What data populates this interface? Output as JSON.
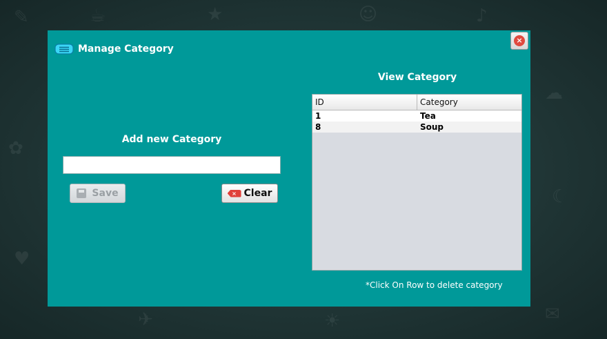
{
  "window": {
    "title": "Manage Category",
    "close_symbol": "×"
  },
  "add_section": {
    "heading": "Add new Category",
    "input_value": "",
    "save_label": "Save",
    "clear_label": "Clear",
    "clear_icon_symbol": "×"
  },
  "view_section": {
    "heading": "View Category",
    "columns": [
      "ID",
      "Category"
    ],
    "rows": [
      {
        "id": "1",
        "category": "Tea"
      },
      {
        "id": "8",
        "category": "Soup"
      }
    ],
    "hint": "*Click On Row to delete category"
  },
  "colors": {
    "panel": "#009999",
    "background": "#1f3434",
    "close_red": "#e04a3f"
  },
  "icons": {
    "title": "menu-list-icon",
    "close": "close-circle-icon",
    "save": "floppy-disk-icon",
    "clear": "backspace-clear-icon"
  }
}
